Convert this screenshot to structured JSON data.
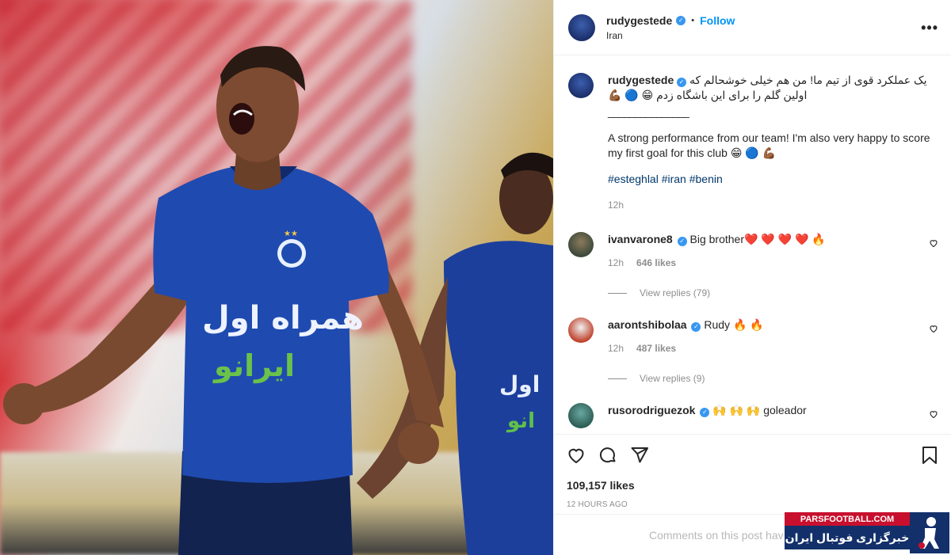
{
  "post": {
    "username": "rudygestede",
    "follow_label": "Follow",
    "location": "Iran",
    "more_glyph": "•••",
    "dot": "•"
  },
  "caption": {
    "username": "rudygestede",
    "persian_text": "یک عملکرد قوی از تیم ما! من هم خیلی خوشحالم که اولین گلم را برای این باشگاه زدم 😁 🔵 💪🏾",
    "separator": "_______________",
    "english_text": "A strong performance from our team! I'm also very happy to score my first goal for this club 😁 🔵 💪🏾",
    "hashtags": "#esteghlal #iran #benin",
    "time": "12h"
  },
  "comments": [
    {
      "username": "ivanvarone8",
      "text": "Big brother❤️ ❤️ ❤️ ❤️ 🔥",
      "time": "12h",
      "likes": "646 likes",
      "view_replies": "View replies (79)"
    },
    {
      "username": "aarontshibolaa",
      "text": "Rudy 🔥 🔥",
      "time": "12h",
      "likes": "487 likes",
      "view_replies": "View replies (9)"
    },
    {
      "username": "rusorodriguezok",
      "text": "🙌 🙌 🙌 goleador"
    }
  ],
  "actions": {
    "likes_total": "109,157 likes",
    "posted_ago": "12 HOURS AGO"
  },
  "comment_box": {
    "placeholder": "Comments on this post hav"
  },
  "watermark": {
    "site": "PARSFOOTBALL.COM",
    "tagline": "خبرگزاری فوتبال ایران"
  },
  "colors": {
    "link_blue": "#0095f6",
    "hashtag_blue": "#00376b",
    "verified_blue": "#3897f0",
    "muted_gray": "#8e8e8e",
    "watermark_red": "#c8102e",
    "watermark_navy": "#13306b"
  }
}
